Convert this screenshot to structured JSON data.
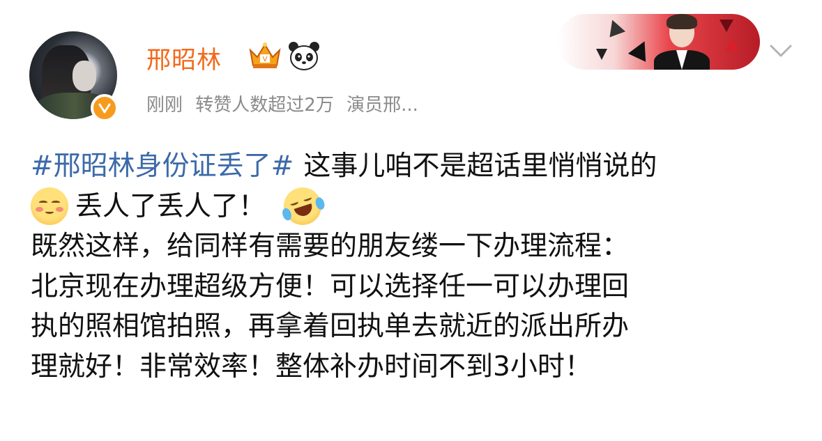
{
  "post": {
    "username": "邢昭林",
    "meta": {
      "time": "刚刚",
      "stat": "转赞人数超过2万",
      "source": "演员邢..."
    },
    "icons": {
      "avatar_badge": "verified-icon",
      "user_badges": [
        "crown-icon",
        "panda-icon"
      ],
      "menu": "chevron-down-icon"
    },
    "colors": {
      "username": "#f26a1b",
      "topic": "#3c6aa8",
      "meta": "#8a8a8a",
      "verified": "#f79b1e"
    }
  },
  "content": {
    "line1": {
      "topic": "#邢昭林身份证丢了#",
      "text": "这事儿咱不是超话里悄悄说的"
    },
    "line2": {
      "text": "丢人了丢人了！"
    },
    "line3": "既然这样，给同样有需要的朋友缕一下办理流程：",
    "line4": "北京现在办理超级方便！可以选择任一可以办理回",
    "line5": "执的照相馆拍照，再拿着回执单去就近的派出所办",
    "line6": "理就好！非常效率！整体补办时间不到3小时！"
  }
}
